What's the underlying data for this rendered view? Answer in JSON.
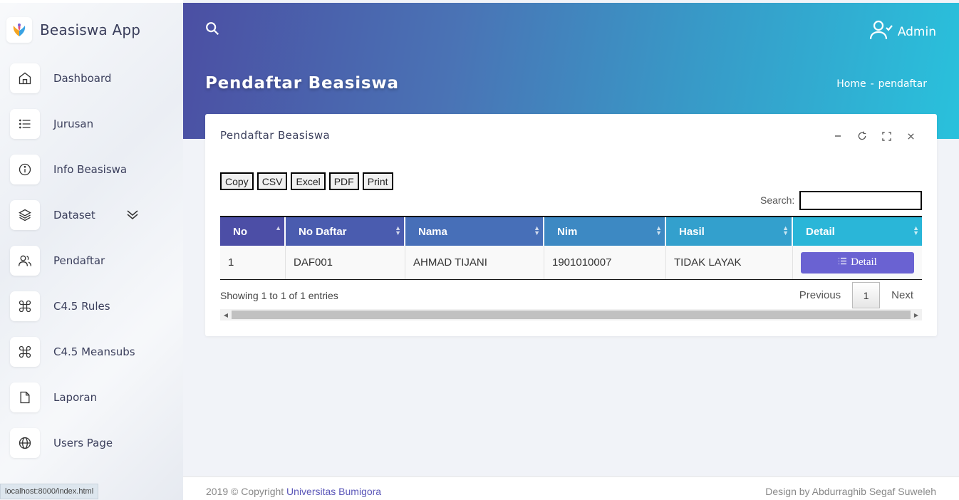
{
  "app": {
    "title": "Beasiswa App"
  },
  "sidebar": {
    "items": [
      {
        "label": "Dashboard",
        "icon": "home-icon"
      },
      {
        "label": "Jurusan",
        "icon": "list-icon"
      },
      {
        "label": "Info Beasiswa",
        "icon": "info-icon"
      },
      {
        "label": "Dataset",
        "icon": "layers-icon"
      },
      {
        "label": "Pendaftar",
        "icon": "users-icon"
      },
      {
        "label": "C4.5 Rules",
        "icon": "command-icon"
      },
      {
        "label": "C4.5 Meansubs",
        "icon": "command-icon"
      },
      {
        "label": "Laporan",
        "icon": "file-icon"
      },
      {
        "label": "Users Page",
        "icon": "globe-icon"
      }
    ]
  },
  "header": {
    "user_name": "Admin",
    "page_title": "Pendaftar Beasiswa",
    "breadcrumb": {
      "home": "Home",
      "separator": "-",
      "current": "pendaftar"
    }
  },
  "card": {
    "title": "Pendaftar Beasiswa",
    "export_buttons": [
      "Copy",
      "CSV",
      "Excel",
      "PDF",
      "Print"
    ],
    "search_label": "Search:",
    "search_value": ""
  },
  "table": {
    "columns": [
      "No",
      "No Daftar",
      "Nama",
      "Nim",
      "Hasil",
      "Detail"
    ],
    "rows": [
      {
        "no": "1",
        "no_daftar": "DAF001",
        "nama": "AHMAD TIJANI",
        "nim": "1901010007",
        "hasil": "TIDAK LAYAK",
        "detail_label": "Detail"
      }
    ],
    "info": "Showing 1 to 1 of 1 entries",
    "pagination": {
      "previous": "Previous",
      "current": "1",
      "next": "Next"
    }
  },
  "footer": {
    "left_prefix": "2019 © Copyright",
    "left_link": "Universitas Bumigora",
    "right": "Design by Abdurraghib Segaf Suweleh"
  },
  "status_bar": {
    "url": "localhost:8000/index.html"
  },
  "colors": {
    "header_gradient_start": "#4b4fa3",
    "header_gradient_end": "#29c1dc",
    "detail_button": "#6a62d2",
    "footer_link": "#5a56b8"
  }
}
